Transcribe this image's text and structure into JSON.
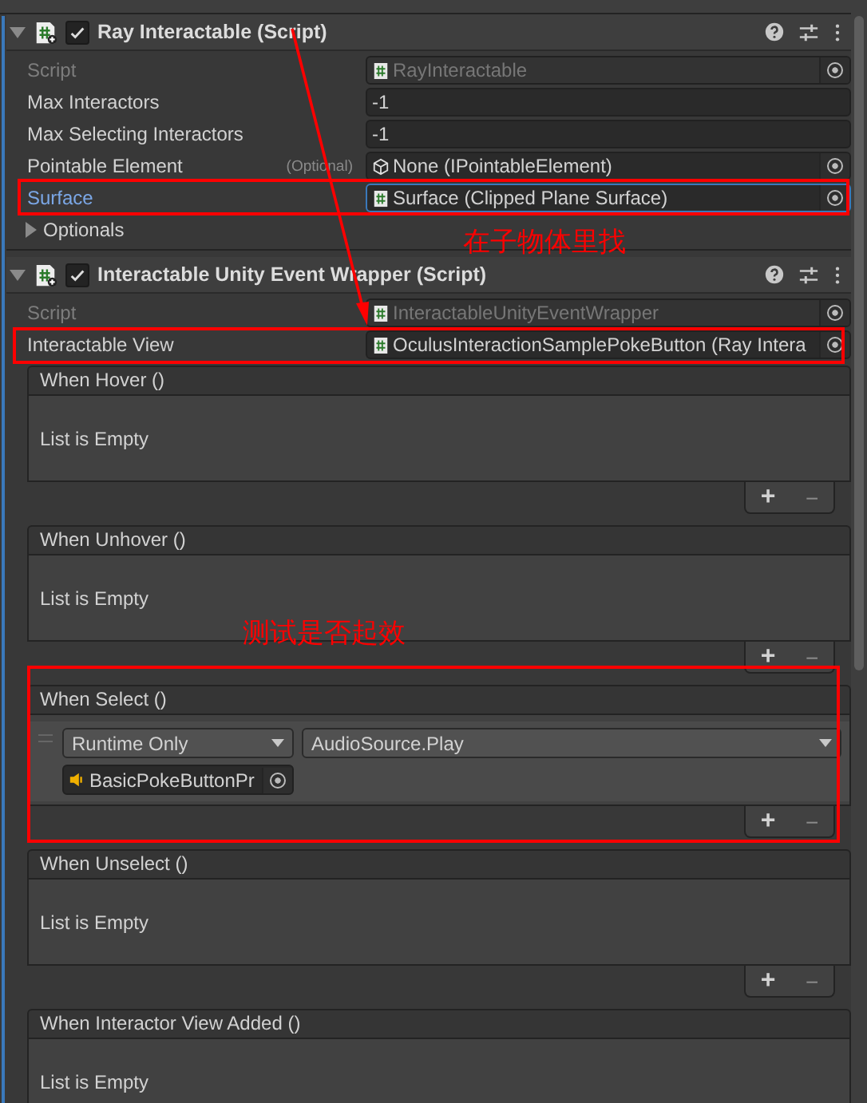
{
  "components": [
    {
      "title": "Ray Interactable (Script)",
      "expanded": true,
      "enabled": true,
      "fields": [
        {
          "label": "Script",
          "kind": "script_ref",
          "value": "RayInteractable",
          "disabled": true,
          "highlighted": false
        },
        {
          "label": "Max Interactors",
          "kind": "number",
          "value": "-1",
          "disabled": false,
          "highlighted": false
        },
        {
          "label": "Max Selecting Interactors",
          "kind": "number",
          "value": "-1",
          "disabled": false,
          "highlighted": false
        },
        {
          "label": "Pointable Element",
          "hint": "(Optional)",
          "kind": "interface_ref",
          "value": "None (IPointableElement)",
          "disabled": false,
          "highlighted": false
        },
        {
          "label": "Surface",
          "kind": "script_ref",
          "value": "Surface (Clipped Plane Surface)",
          "disabled": false,
          "highlighted": true
        }
      ],
      "foldouts": [
        {
          "label": "Optionals",
          "expanded": false
        }
      ]
    },
    {
      "title": "Interactable Unity Event Wrapper (Script)",
      "expanded": true,
      "enabled": true,
      "fields": [
        {
          "label": "Script",
          "kind": "script_ref",
          "value": "InteractableUnityEventWrapper",
          "disabled": true,
          "highlighted": false
        },
        {
          "label": "Interactable View",
          "kind": "script_ref",
          "value": "OculusInteractionSamplePokeButton (Ray Intera",
          "disabled": false,
          "highlighted": false
        }
      ],
      "events": [
        {
          "title": "When Hover ()",
          "empty_text": "List is Empty",
          "add_label": "+",
          "remove_label": "−"
        },
        {
          "title": "When Unhover ()",
          "empty_text": "List is Empty",
          "add_label": "+",
          "remove_label": "−"
        },
        {
          "title": "When Select ()",
          "items": [
            {
              "mode": "Runtime Only",
              "function": "AudioSource.Play",
              "target": "BasicPokeButtonPr",
              "kind": "audio_ref"
            }
          ],
          "add_label": "+",
          "remove_label": "−"
        },
        {
          "title": "When Unselect ()",
          "empty_text": "List is Empty",
          "add_label": "+",
          "remove_label": "−"
        },
        {
          "title": "When Interactor View Added ()",
          "empty_text": "List is Empty"
        }
      ]
    }
  ],
  "annotations": [
    {
      "text": "在子物体里找"
    },
    {
      "text": "测试是否起效"
    }
  ]
}
